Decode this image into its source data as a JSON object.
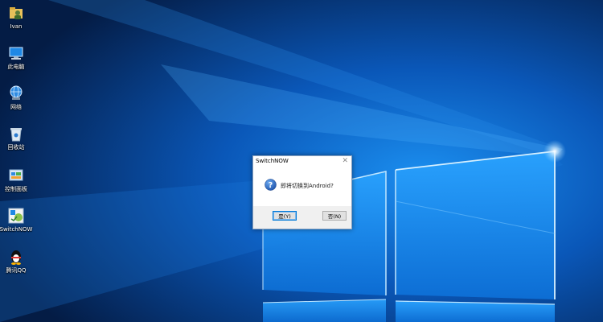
{
  "desktop": {
    "icons": [
      {
        "label": "Ivan",
        "icon": "user-folder-icon"
      },
      {
        "label": "此电脑",
        "icon": "this-pc-icon"
      },
      {
        "label": "网络",
        "icon": "network-icon"
      },
      {
        "label": "回收站",
        "icon": "recycle-bin-icon"
      },
      {
        "label": "控制面板",
        "icon": "control-panel-icon"
      },
      {
        "label": "SwitchNOW",
        "icon": "switchnow-app-icon"
      },
      {
        "label": "腾讯QQ",
        "icon": "qq-penguin-icon"
      }
    ],
    "wallpaper": "windows-10-hero",
    "accent": "#0a6fd8"
  },
  "dialog": {
    "title": "SwitchNOW",
    "close_symbol": "✕",
    "icon": "question-icon",
    "message": "即将切换到Android?",
    "yes_label": "是(Y)",
    "no_label": "否(N)"
  }
}
